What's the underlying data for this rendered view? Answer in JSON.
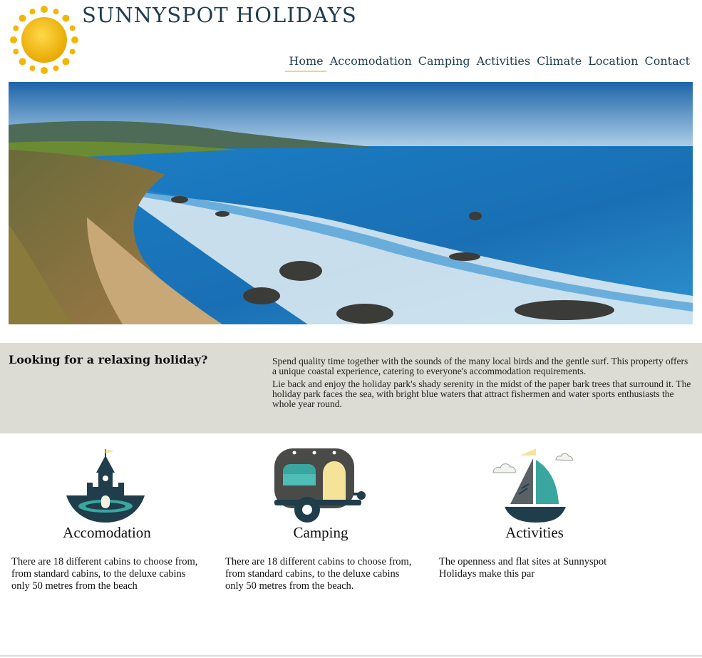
{
  "site": {
    "title": "SUNNYSPOT HOLIDAYS",
    "logo_icon": "sun-icon"
  },
  "nav": {
    "items": [
      {
        "label": "Home",
        "active": true
      },
      {
        "label": "Accomodation",
        "active": false
      },
      {
        "label": "Camping",
        "active": false
      },
      {
        "label": "Activities",
        "active": false
      },
      {
        "label": "Climate",
        "active": false
      },
      {
        "label": "Location",
        "active": false
      },
      {
        "label": "Contact",
        "active": false
      }
    ],
    "active_underline_color": "#e6d68a"
  },
  "hero": {
    "image": "coastal-beach-photo"
  },
  "intro": {
    "heading": "Looking for a relaxing holiday?",
    "paragraph_1": "Spend quality time together with the sounds of the many local birds and the gentle surf. This property offers a unique coastal experience, catering to everyone's accommodation requirements.",
    "paragraph_2": "Lie back and enjoy the holiday park's shady serenity in the midst of the paper bark trees that surround it. The holiday park faces the sea, with bright blue waters that attract fishermen and water sports enthusiasts the whole year round.",
    "background": "#dcdcd4"
  },
  "features": [
    {
      "title": "Accomodation",
      "icon": "castle-icon",
      "text": "There are 18 different cabins to choose from, from standard cabins, to the deluxe cabins only 50 metres from the beach"
    },
    {
      "title": "Camping",
      "icon": "caravan-icon",
      "text": "There are 18 different cabins to choose from, from standard cabins, to the deluxe cabins only 50 metres from the beach."
    },
    {
      "title": "Activities",
      "icon": "sailboat-icon",
      "text": "The openness and flat sites at Sunnyspot Holidays make this par"
    }
  ],
  "colors": {
    "brand_dark": "#1f3d4a",
    "teal": "#3aa6a0",
    "yellow": "#f5e39a",
    "sun": "#f2b705"
  }
}
